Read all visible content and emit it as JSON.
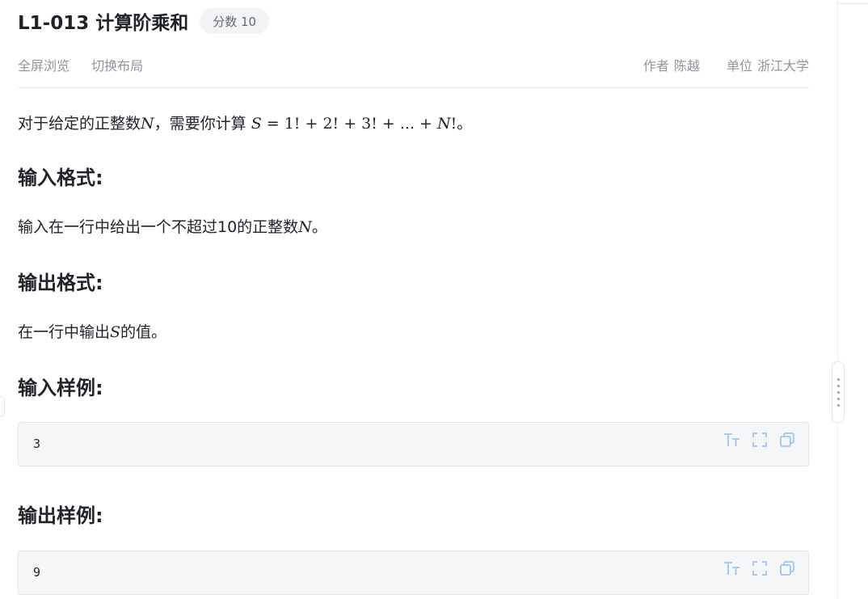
{
  "problem": {
    "title": "L1-013 计算阶乘和",
    "score_badge": "分数 10"
  },
  "toolbar": {
    "fullscreen_label": "全屏浏览",
    "switch_layout_label": "切换布局",
    "author_label": "作者",
    "author_value": "陈越",
    "unit_label": "单位",
    "unit_value": "浙江大学"
  },
  "description": {
    "intro_prefix": "对于给定的正整数",
    "intro_N": "N",
    "intro_middle": "，需要你计算 ",
    "intro_formula": "S = 1! + 2! + 3! + ... + N!",
    "intro_suffix": "。"
  },
  "input_format": {
    "heading": "输入格式:",
    "text_prefix": "输入在一行中给出一个不超过10的正整数",
    "text_N": "N",
    "text_suffix": "。"
  },
  "output_format": {
    "heading": "输出格式:",
    "text_prefix": "在一行中输出",
    "text_S": "S",
    "text_suffix": "的值。"
  },
  "sample_input": {
    "heading": "输入样例:",
    "code": "3"
  },
  "sample_output": {
    "heading": "输出样例:",
    "code": "9"
  },
  "code_tool_icons": [
    "font-size-icon",
    "expand-icon",
    "copy-icon"
  ],
  "colors": {
    "accent_icon": "#9ec5f0",
    "meta_text": "#8f959e"
  }
}
